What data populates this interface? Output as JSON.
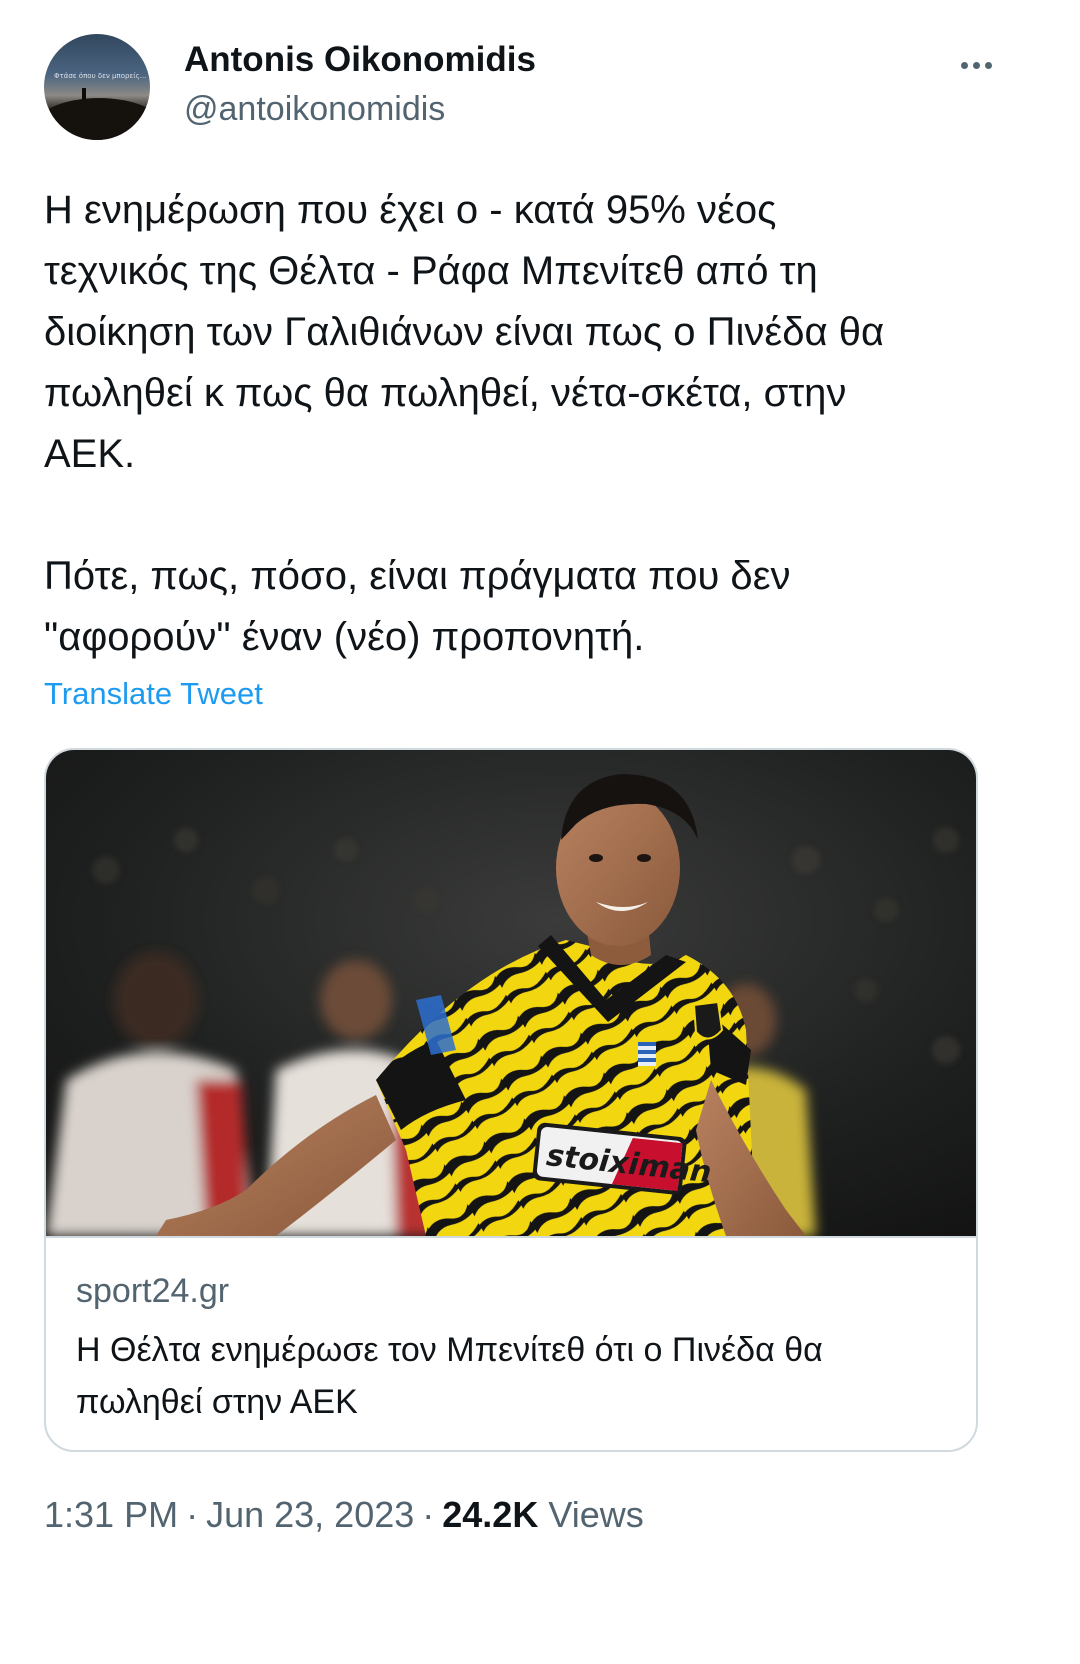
{
  "author": {
    "display_name": "Antonis Oikonomidis",
    "handle": "@antoikonomidis",
    "avatar_caption": "Φτάσε όπου δεν μπορείς..."
  },
  "more_icon": "more-horizontal-icon",
  "tweet": {
    "text": "Η ενημέρωση που έχει ο - κατά 95% νέος\nτεχνικός της Θέλτα - Ράφα Μπενίτεθ από τη\nδιοίκηση των Γαλιθιάνων είναι πως ο Πινέδα θα\nπωληθεί κ πως θα πωληθεί, νέτα-σκέτα, στην\nΑΕΚ.\n\nΠότε, πως, πόσο, είναι πράγματα που δεν\n\"αφορούν\" έναν (νέο) προπονητή.",
    "translate_label": "Translate Tweet"
  },
  "link_card": {
    "image_alt": "Football player in yellow and black striped jersey celebrating",
    "sponsor_logo_text": "stoiximan",
    "domain": "sport24.gr",
    "title": "Η Θέλτα ενημέρωσε τον Μπενίτεθ ότι ο Πινέδα θα πωληθεί στην ΑΕΚ"
  },
  "meta": {
    "time": "1:31 PM",
    "separator": "·",
    "date": "Jun 23, 2023",
    "views_count": "24.2K",
    "views_label": "Views"
  },
  "colors": {
    "text_primary": "#0f1419",
    "text_secondary": "#536471",
    "link_blue": "#1d9bf0",
    "border": "#cfd9de",
    "jersey_yellow": "#f2d60f",
    "jersey_black": "#141414"
  }
}
